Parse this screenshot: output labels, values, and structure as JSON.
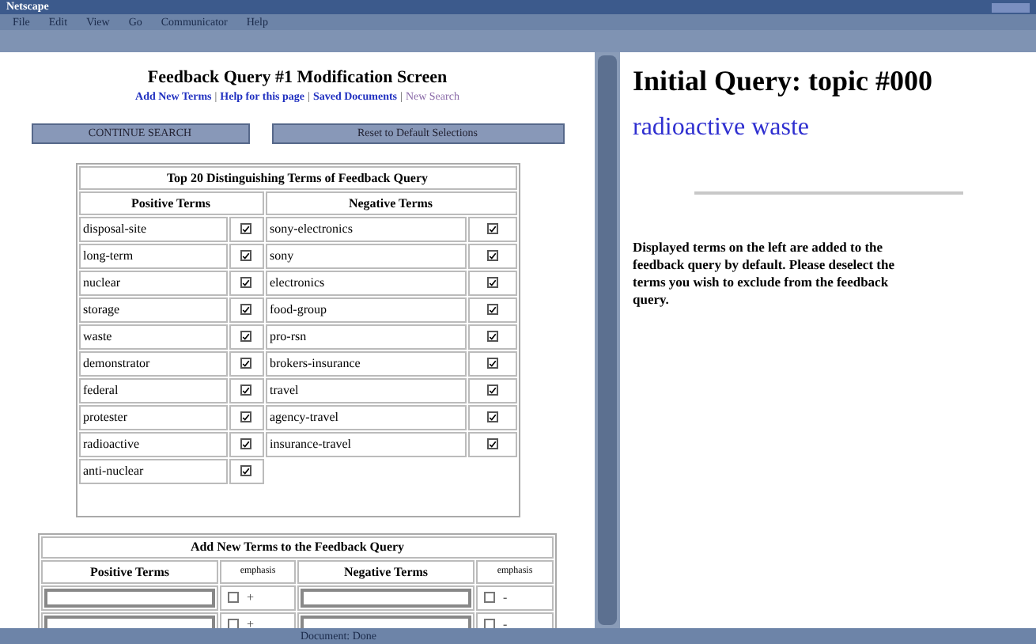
{
  "window": {
    "title": "Netscape"
  },
  "menu": [
    "File",
    "Edit",
    "View",
    "Go",
    "Communicator",
    "Help"
  ],
  "left": {
    "heading": "Feedback Query #1 Modification Screen",
    "link_separator": "|",
    "links": [
      {
        "label": "Add New Terms",
        "visited": false
      },
      {
        "label": "Help for this page",
        "visited": false
      },
      {
        "label": "Saved Documents",
        "visited": false
      },
      {
        "label": "New Search",
        "visited": true
      }
    ],
    "buttons": [
      "CONTINUE SEARCH",
      "Reset to Default Selections"
    ],
    "terms_table": {
      "title": "Top 20 Distinguishing Terms of Feedback Query",
      "columns": [
        "Positive Terms",
        "Negative Terms"
      ],
      "positive": [
        {
          "term": "disposal-site",
          "checked": true
        },
        {
          "term": "long-term",
          "checked": true
        },
        {
          "term": "nuclear",
          "checked": true
        },
        {
          "term": "storage",
          "checked": true
        },
        {
          "term": "waste",
          "checked": true
        },
        {
          "term": "demonstrator",
          "checked": true
        },
        {
          "term": "federal",
          "checked": true
        },
        {
          "term": "protester",
          "checked": true
        },
        {
          "term": "radioactive",
          "checked": true
        },
        {
          "term": "anti-nuclear",
          "checked": true
        }
      ],
      "negative": [
        {
          "term": "sony-electronics",
          "checked": true
        },
        {
          "term": "sony",
          "checked": true
        },
        {
          "term": "electronics",
          "checked": true
        },
        {
          "term": "food-group",
          "checked": true
        },
        {
          "term": "pro-rsn",
          "checked": true
        },
        {
          "term": "brokers-insurance",
          "checked": true
        },
        {
          "term": "travel",
          "checked": true
        },
        {
          "term": "agency-travel",
          "checked": true
        },
        {
          "term": "insurance-travel",
          "checked": true
        }
      ]
    },
    "add_table": {
      "title": "Add New Terms to the Feedback Query",
      "columns": [
        "Positive Terms",
        "emphasis",
        "Negative Terms",
        "emphasis"
      ],
      "rows": [
        {
          "positive_emphasis": false,
          "positive_sign": "+",
          "negative_emphasis": false,
          "negative_sign": "-"
        },
        {
          "positive_emphasis": false,
          "positive_sign": "+",
          "negative_emphasis": false,
          "negative_sign": "-"
        }
      ]
    }
  },
  "right": {
    "heading": "Initial Query: topic #000",
    "query": "radioactive waste",
    "description": "Displayed terms on the left are added to the feedback query by default. Please deselect the terms you wish to exclude from the feedback query."
  },
  "status_bar": {
    "text": "Document: Done"
  }
}
